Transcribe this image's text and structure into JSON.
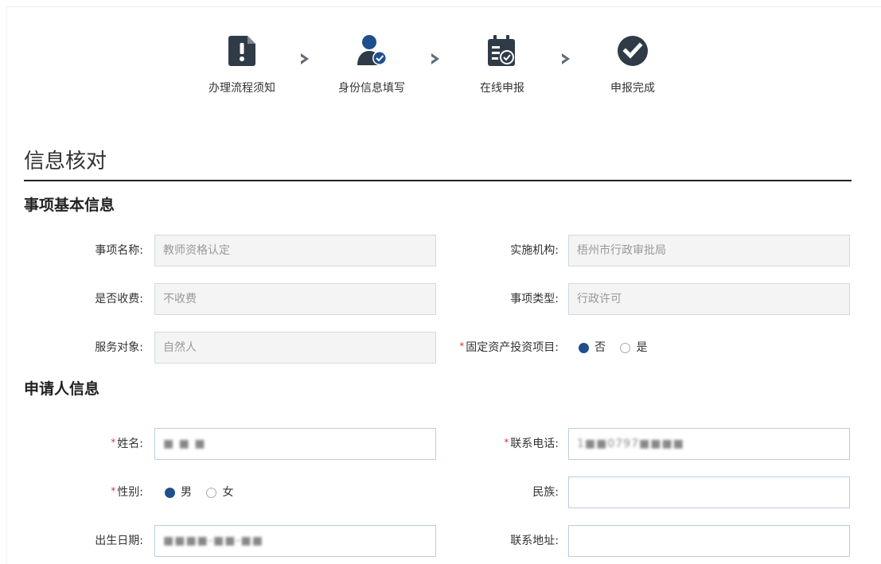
{
  "steps": [
    {
      "label": "办理流程须知",
      "icon": "document-exclamation-icon"
    },
    {
      "label": "身份信息填写",
      "icon": "user-check-icon"
    },
    {
      "label": "在线申报",
      "icon": "calendar-check-icon"
    },
    {
      "label": "申报完成",
      "icon": "check-circle-icon"
    }
  ],
  "page_title": "信息核对",
  "sections": {
    "basic": {
      "title": "事项基本信息",
      "item_name_label": "事项名称:",
      "item_name_value": "教师资格认定",
      "org_label": "实施机构:",
      "org_value": "梧州市行政审批局",
      "fee_label": "是否收费:",
      "fee_value": "不收费",
      "type_label": "事项类型:",
      "type_value": "行政许可",
      "target_label": "服务对象:",
      "target_value": "自然人",
      "invest_label": "固定资产投资项目:",
      "invest_options": [
        "否",
        "是"
      ],
      "invest_selected": "否"
    },
    "applicant": {
      "title": "申请人信息",
      "name_label": "姓名:",
      "name_value": "■ ■ ■",
      "phone_label": "联系电话:",
      "phone_value": "1■■0797■■■■",
      "gender_label": "性别:",
      "gender_options": [
        "男",
        "女"
      ],
      "gender_selected": "男",
      "ethnicity_label": "民族:",
      "ethnicity_value": "",
      "birth_label": "出生日期:",
      "birth_value": "■■■■-■■-■■",
      "address_label": "联系地址:",
      "address_value": ""
    }
  },
  "colors": {
    "accent": "#1f4f8c",
    "icon_dark": "#2f3b46",
    "required": "#d9363e"
  }
}
